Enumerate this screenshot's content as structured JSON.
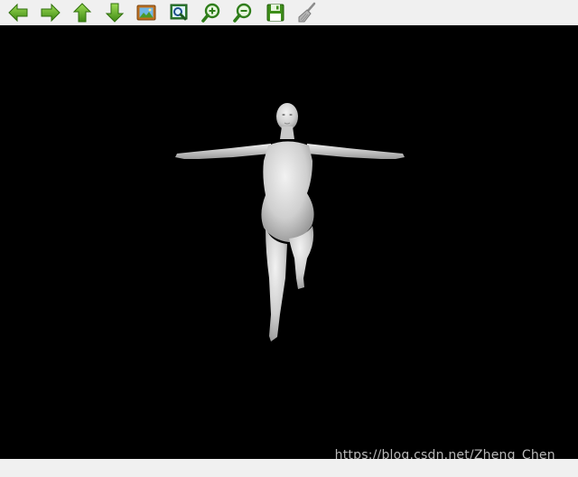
{
  "toolbar": {
    "buttons": [
      {
        "icon": "arrow-left-icon",
        "tooltip": "Back"
      },
      {
        "icon": "arrow-right-icon",
        "tooltip": "Forward"
      },
      {
        "icon": "arrow-up-icon",
        "tooltip": "Up"
      },
      {
        "icon": "arrow-down-icon",
        "tooltip": "Down"
      },
      {
        "icon": "picture-icon",
        "tooltip": "Image"
      },
      {
        "icon": "zoom-fit-icon",
        "tooltip": "Fit"
      },
      {
        "icon": "zoom-in-icon",
        "tooltip": "Zoom in"
      },
      {
        "icon": "zoom-out-icon",
        "tooltip": "Zoom out"
      },
      {
        "icon": "save-icon",
        "tooltip": "Save"
      },
      {
        "icon": "broom-icon",
        "tooltip": "Clear"
      }
    ],
    "accent_green": "#4c9a1c",
    "accent_green_light": "#8fd24a"
  },
  "viewport": {
    "background": "#000000",
    "model_color": "#d9d9d9",
    "watermark": "https://blog.csdn.net/Zheng_Chen_"
  }
}
